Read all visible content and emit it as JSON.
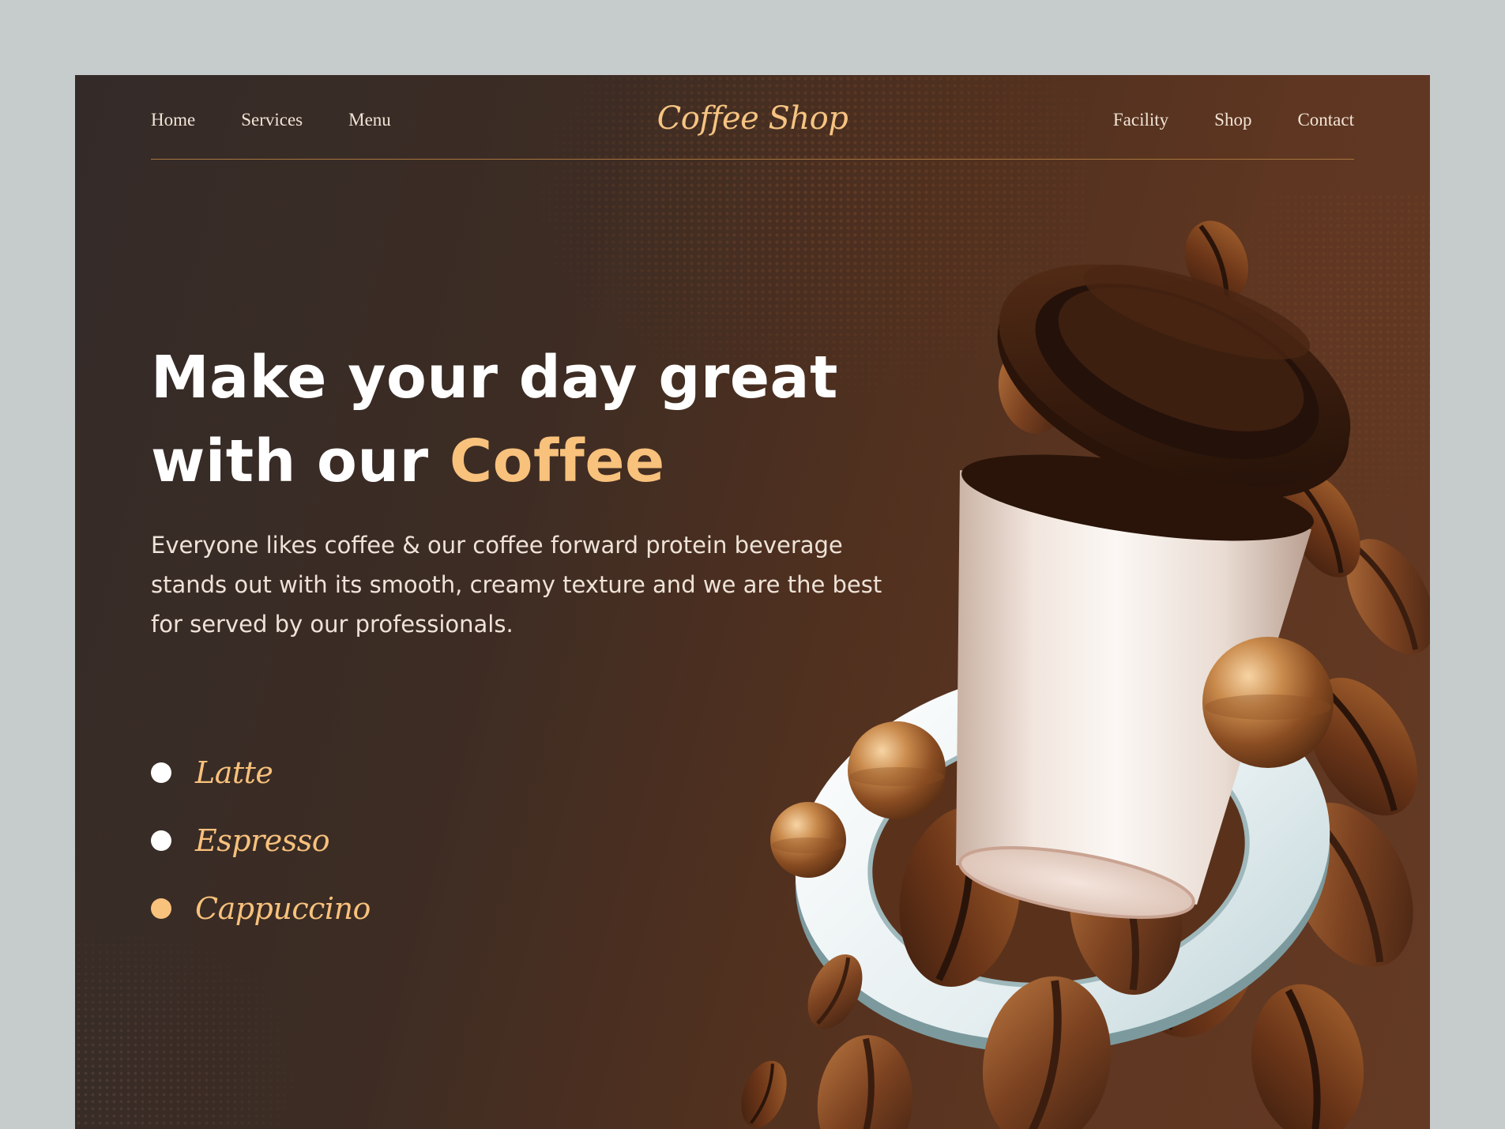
{
  "nav": {
    "left": [
      "Home",
      "Services",
      "Menu"
    ],
    "brand": "Coffee Shop",
    "right": [
      "Facility",
      "Shop",
      "Contact"
    ]
  },
  "hero": {
    "headline_line1": "Make your day great",
    "headline_line2_prefix": "with our ",
    "headline_accent": "Coffee",
    "description": "Everyone likes coffee & our coffee forward protein beverage stands out with its smooth, creamy texture and we are the best for served by our professionals."
  },
  "menu": {
    "items": [
      {
        "label": "Latte",
        "active": false
      },
      {
        "label": "Espresso",
        "active": false
      },
      {
        "label": "Cappuccino",
        "active": true
      }
    ]
  },
  "colors": {
    "accent": "#f8c17c",
    "background_dark": "#342b28",
    "background_brown": "#643a24",
    "outer_bg": "#c6cbcb"
  },
  "illustration": {
    "icons": [
      "coffee-cup",
      "cup-lid",
      "saucer-ring",
      "coffee-beans",
      "caramel-balls"
    ]
  }
}
